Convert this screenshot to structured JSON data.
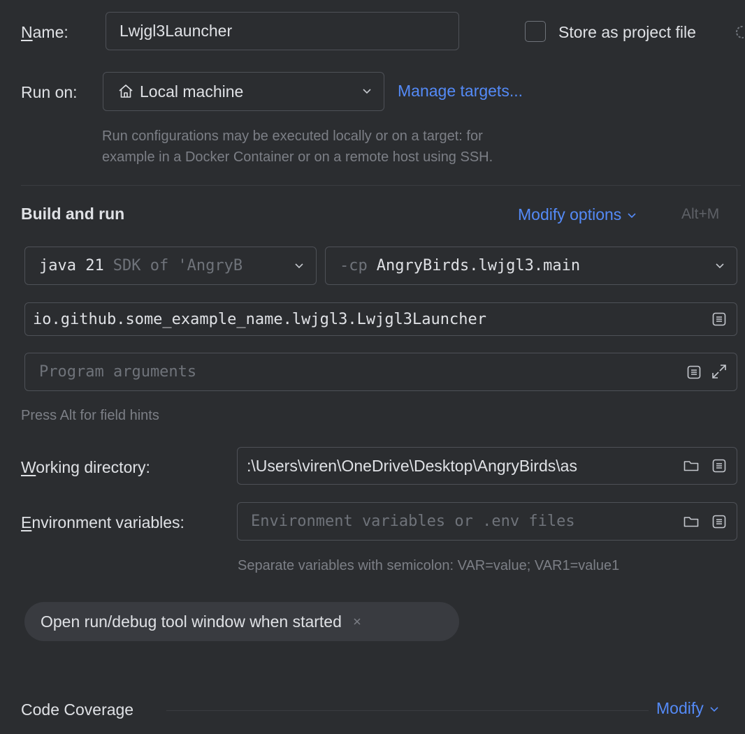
{
  "name_row": {
    "label_mnemonic": "N",
    "label_rest": "ame:",
    "value": "Lwjgl3Launcher",
    "store_label": "Store as project file",
    "store_checked": false
  },
  "run_on": {
    "label": "Run on:",
    "target": "Local machine",
    "target_icon": "home-icon",
    "manage_link": "Manage targets...",
    "hint_line1": "Run configurations may be executed locally or on a target: for",
    "hint_line2": "example in a Docker Container or on a remote host using SSH."
  },
  "build_and_run": {
    "title": "Build and run",
    "modify_options": "Modify options",
    "shortcut": "Alt+M",
    "jre_main": "java 21",
    "jre_hint": "SDK of 'AngryB",
    "cp_prefix": "-cp",
    "cp_module": "AngryBirds.lwjgl3.main",
    "main_class": "io.github.some_example_name.lwjgl3.Lwjgl3Launcher",
    "program_args_placeholder": "Program arguments",
    "field_hint": "Press Alt for field hints"
  },
  "working_dir": {
    "label_mnemonic": "W",
    "label_rest": "orking directory:",
    "value": ":\\Users\\viren\\OneDrive\\Desktop\\AngryBirds\\as"
  },
  "env_vars": {
    "label_mnemonic": "E",
    "label_rest": "nvironment variables:",
    "placeholder": "Environment variables or .env files",
    "hint": "Separate variables with semicolon: VAR=value; VAR1=value1"
  },
  "option_chip": {
    "label": "Open run/debug tool window when started"
  },
  "code_coverage": {
    "title": "Code Coverage",
    "modify": "Modify"
  },
  "colors": {
    "background": "#2b2d30",
    "border": "#4e5157",
    "text": "#dfe1e5",
    "hint": "#7c7f86",
    "link": "#548af7",
    "chip": "#393b40"
  }
}
